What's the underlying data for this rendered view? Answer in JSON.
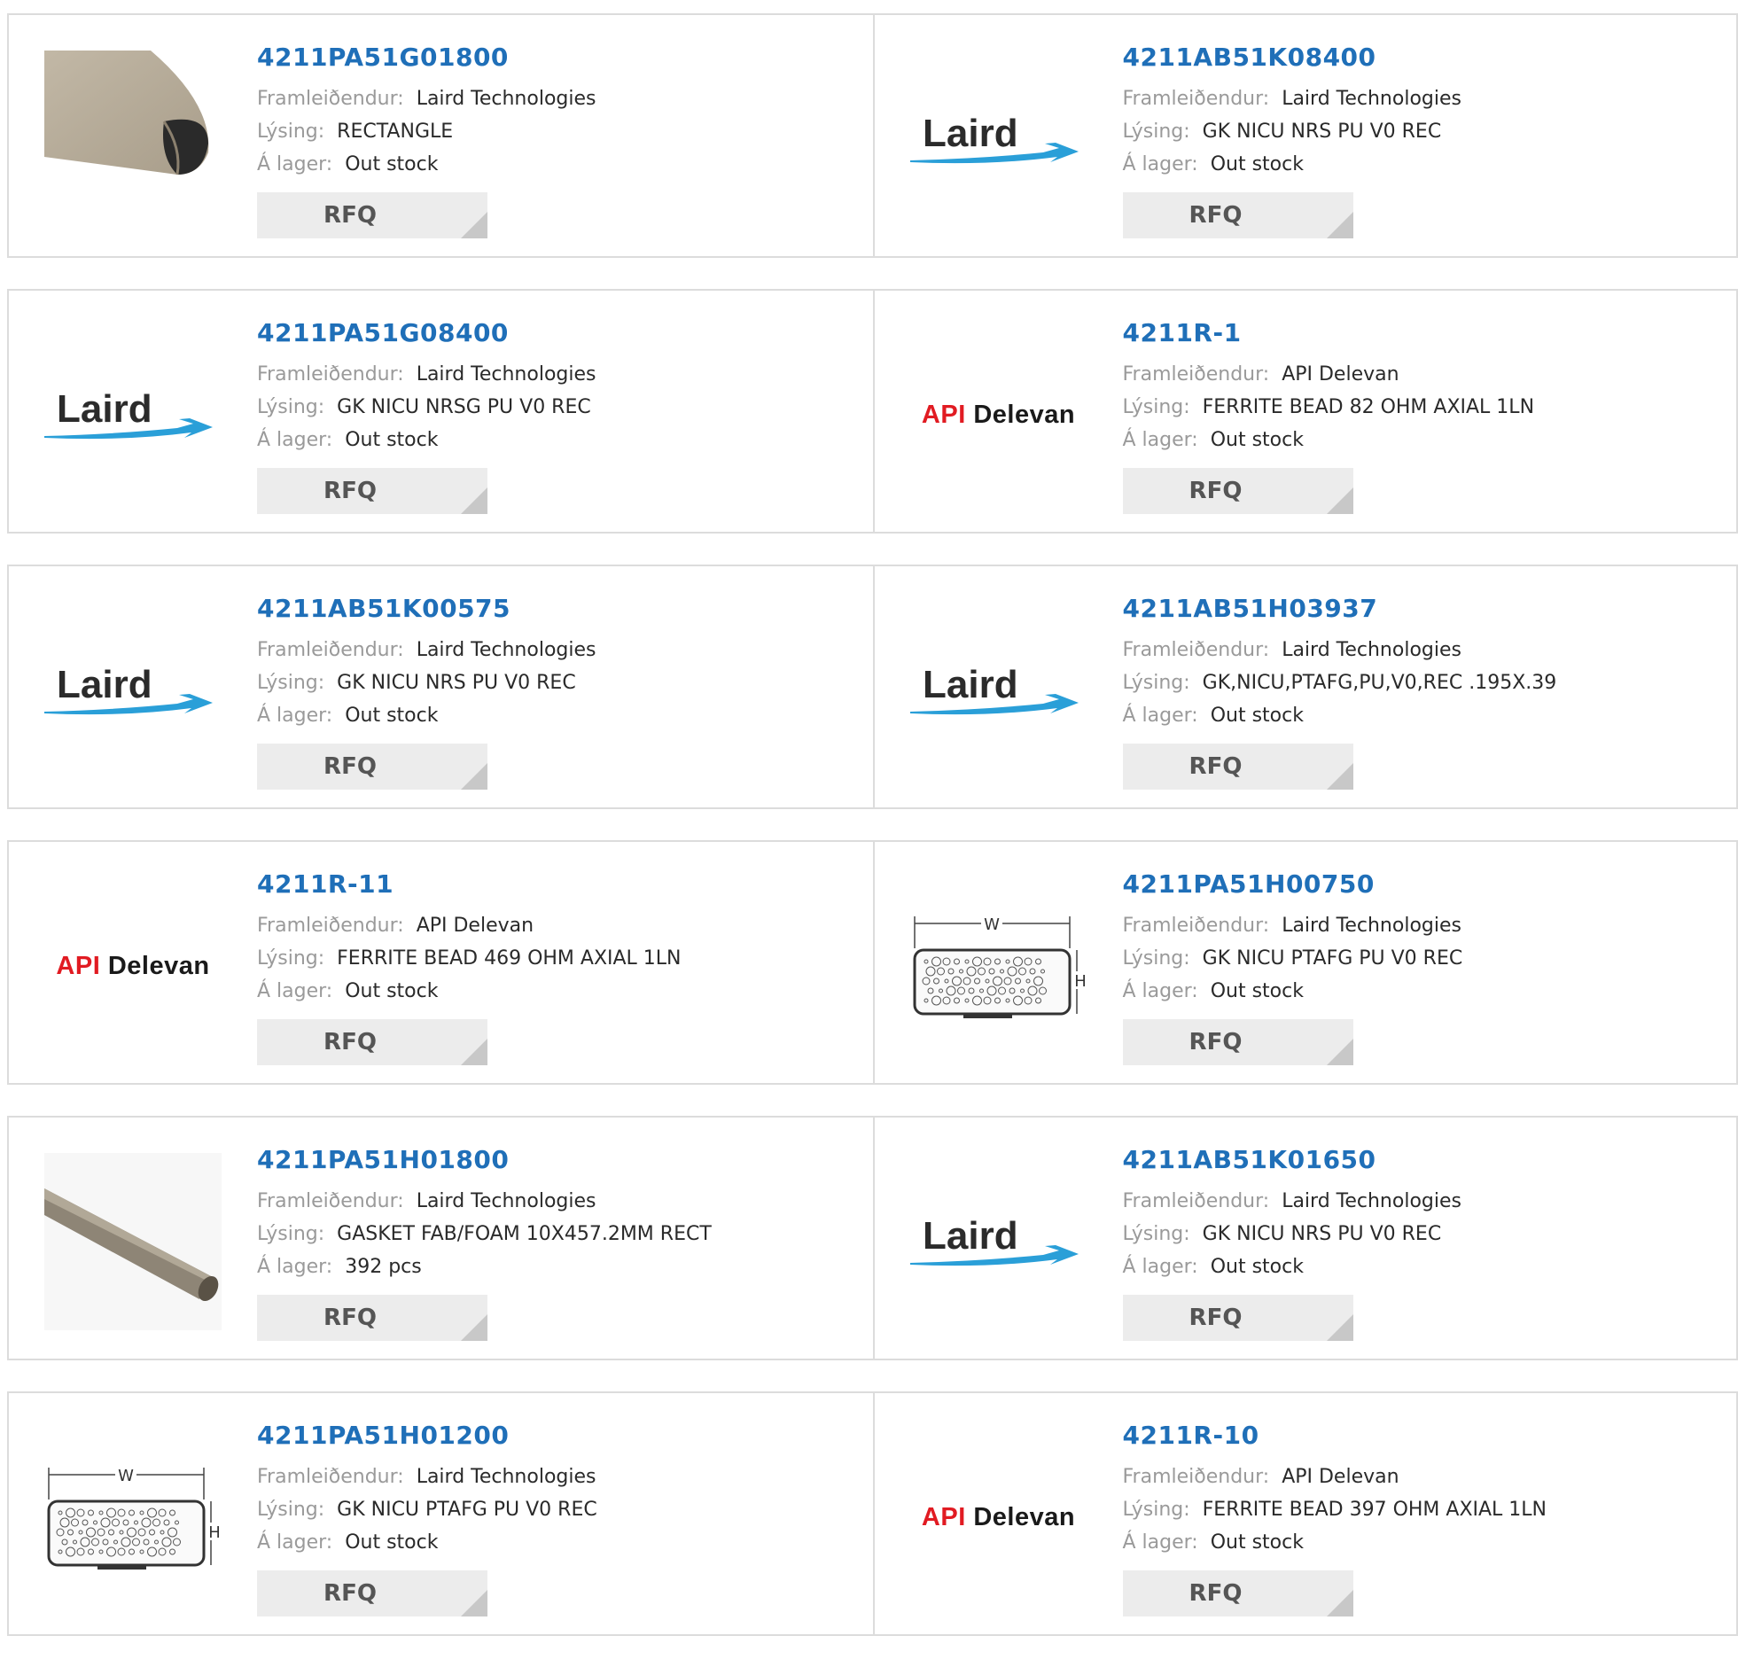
{
  "labels": {
    "manufacturer": "Framleiðendur:",
    "description": "Lýsing:",
    "stock": "Á lager:",
    "rfq": "RFQ"
  },
  "colors": {
    "part_number": "#1f6fb8",
    "label": "#9a9a9a",
    "rfq_bg": "#ececec",
    "border": "#dcdcdc"
  },
  "logos": {
    "laird": "Laird",
    "api_red": "API",
    "api_black": "Delevan"
  },
  "diagram": {
    "w": "W",
    "h": "H"
  },
  "products": [
    {
      "part_number": "4211PA51G01800",
      "manufacturer": "Laird Technologies",
      "description": "RECTANGLE",
      "stock": "Out stock",
      "image": "foam-rect-photo"
    },
    {
      "part_number": "4211AB51K08400",
      "manufacturer": "Laird Technologies",
      "description": "GK NICU NRS PU V0 REC",
      "stock": "Out stock",
      "image": "laird-logo"
    },
    {
      "part_number": "4211PA51G08400",
      "manufacturer": "Laird Technologies",
      "description": "GK NICU NRSG PU V0 REC",
      "stock": "Out stock",
      "image": "laird-logo"
    },
    {
      "part_number": "4211R-1",
      "manufacturer": "API Delevan",
      "description": "FERRITE BEAD 82 OHM AXIAL 1LN",
      "stock": "Out stock",
      "image": "api-delevan-logo"
    },
    {
      "part_number": "4211AB51K00575",
      "manufacturer": "Laird Technologies",
      "description": "GK NICU NRS PU V0 REC",
      "stock": "Out stock",
      "image": "laird-logo"
    },
    {
      "part_number": "4211AB51H03937",
      "manufacturer": "Laird Technologies",
      "description": "GK,NICU,PTAFG,PU,V0,REC .195X.39",
      "stock": "Out stock",
      "image": "laird-logo"
    },
    {
      "part_number": "4211R-11",
      "manufacturer": "API Delevan",
      "description": "FERRITE BEAD 469 OHM AXIAL 1LN",
      "stock": "Out stock",
      "image": "api-delevan-logo"
    },
    {
      "part_number": "4211PA51H00750",
      "manufacturer": "Laird Technologies",
      "description": "GK NICU PTAFG PU V0 REC",
      "stock": "Out stock",
      "image": "foam-diagram"
    },
    {
      "part_number": "4211PA51H01800",
      "manufacturer": "Laird Technologies",
      "description": "GASKET FAB/FOAM 10X457.2MM RECT",
      "stock": "392 pcs",
      "image": "gasket-strip-photo"
    },
    {
      "part_number": "4211AB51K01650",
      "manufacturer": "Laird Technologies",
      "description": "GK NICU NRS PU V0 REC",
      "stock": "Out stock",
      "image": "laird-logo"
    },
    {
      "part_number": "4211PA51H01200",
      "manufacturer": "Laird Technologies",
      "description": "GK NICU PTAFG PU V0 REC",
      "stock": "Out stock",
      "image": "foam-diagram"
    },
    {
      "part_number": "4211R-10",
      "manufacturer": "API Delevan",
      "description": "FERRITE BEAD 397 OHM AXIAL 1LN",
      "stock": "Out stock",
      "image": "api-delevan-logo"
    }
  ]
}
